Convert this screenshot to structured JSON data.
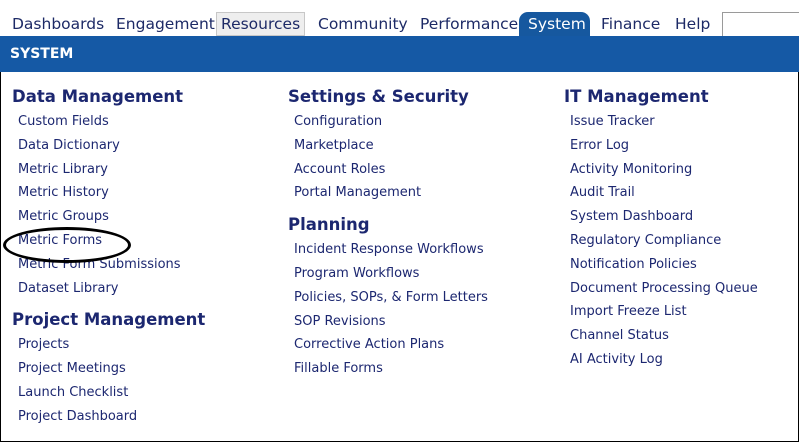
{
  "nav": {
    "tabs": [
      {
        "label": "Dashboards"
      },
      {
        "label": "Engagement"
      },
      {
        "label": "Resources"
      },
      {
        "label": "Community"
      },
      {
        "label": "Performance"
      },
      {
        "label": "System"
      },
      {
        "label": "Finance"
      },
      {
        "label": "Help"
      }
    ],
    "search_value": ""
  },
  "section": {
    "title": "SYSTEM"
  },
  "columns": [
    {
      "groups": [
        {
          "title": "Data Management",
          "items": [
            "Custom Fields",
            "Data Dictionary",
            "Metric Library",
            "Metric History",
            "Metric Groups",
            "Metric Forms",
            "Metric Form Submissions",
            "Dataset Library"
          ]
        },
        {
          "title": "Project Management",
          "items": [
            "Projects",
            "Project Meetings",
            "Launch Checklist",
            "Project Dashboard"
          ]
        }
      ]
    },
    {
      "groups": [
        {
          "title": "Settings & Security",
          "items": [
            "Configuration",
            "Marketplace",
            "Account Roles",
            "Portal Management"
          ]
        },
        {
          "title": "Planning",
          "items": [
            "Incident Response Workflows",
            "Program Workflows",
            "Policies, SOPs, & Form Letters",
            "SOP Revisions",
            "Corrective Action Plans",
            "Fillable Forms"
          ]
        }
      ]
    },
    {
      "groups": [
        {
          "title": "IT Management",
          "items": [
            "Issue Tracker",
            "Error Log",
            "Activity Monitoring",
            "Audit Trail",
            "System Dashboard",
            "Regulatory Compliance",
            "Notification Policies",
            "Document Processing Queue",
            "Import Freeze List",
            "Channel Status",
            "AI Activity Log"
          ]
        }
      ]
    }
  ]
}
